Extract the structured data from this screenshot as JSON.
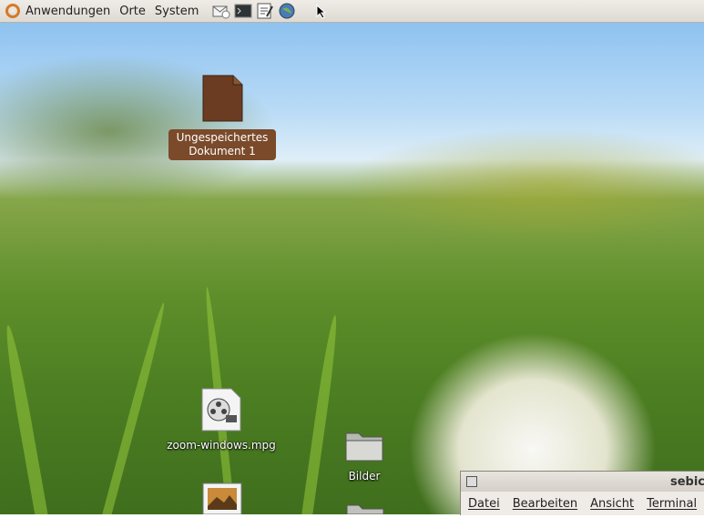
{
  "panel": {
    "menus": [
      "Anwendungen",
      "Orte",
      "System"
    ],
    "launchers": [
      "mail-icon",
      "terminal-icon",
      "text-editor-icon",
      "web-browser-icon"
    ]
  },
  "desktop": {
    "icons": [
      {
        "label": "Ungespeichertes Dokument 1",
        "icon": "document-icon",
        "selected": true
      },
      {
        "label": "zoom-windows.mpg",
        "icon": "video-file-icon"
      },
      {
        "label": "Bilder",
        "icon": "folder-icon"
      }
    ]
  },
  "terminal": {
    "title": "sebic",
    "menu": [
      "Datei",
      "Bearbeiten",
      "Ansicht",
      "Terminal"
    ]
  },
  "colors": {
    "panel": "#efece7",
    "accent": "#d57a27",
    "selection": "#7a4a2a"
  }
}
